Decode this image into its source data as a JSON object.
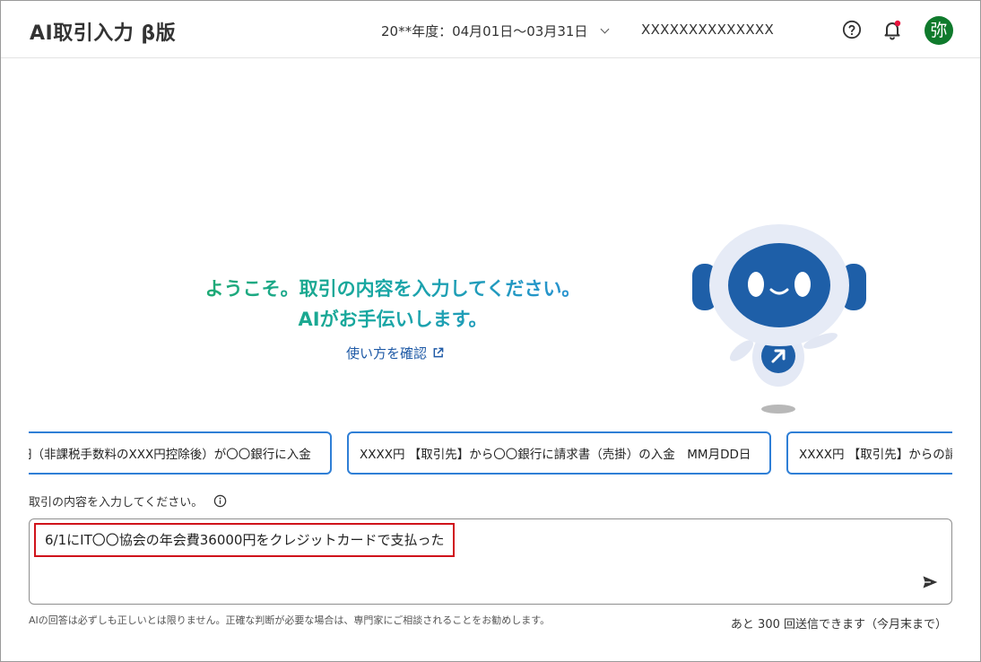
{
  "header": {
    "title": "AI取引入力 β版",
    "fiscal_year": "20**年度：04月01日〜03月31日",
    "company": "XXXXXXXXXXXXXX",
    "avatar_initial": "弥",
    "icons": [
      "help-icon",
      "bell-icon"
    ],
    "notification_dot_color": "#e8123c",
    "avatar_color": "#0f7a2c"
  },
  "welcome": {
    "line1": "ようこそ。取引の内容を入力してください。",
    "line2": "AIがお手伝いします。",
    "howto_link": "使い方を確認"
  },
  "suggestions": [
    "円（非課税手数料のXXX円控除後）が〇〇銀行に入金",
    "XXXX円 【取引先】から〇〇銀行に請求書（売掛）の入金　MM月DD日",
    "XXXX円 【取引先】からの請"
  ],
  "input": {
    "label": "取引の内容を入力してください。",
    "value": "6/1にIT〇〇協会の年会費36000円をクレジットカードで支払った",
    "highlight_color": "#d0131b"
  },
  "footer": {
    "disclaimer": "AIの回答は必ずしも正しいとは限りません。正確な判断が必要な場合は、専門家にご相談されることをお勧めします。",
    "remaining": "あと 300 回送信できます（今月末まで）"
  },
  "colors": {
    "accent_blue": "#2f7fd6",
    "link_blue": "#1f5aa6",
    "robot_blue": "#1e5fa8",
    "welcome_gradient": [
      "#1faa6e",
      "#2a8fd8"
    ]
  }
}
